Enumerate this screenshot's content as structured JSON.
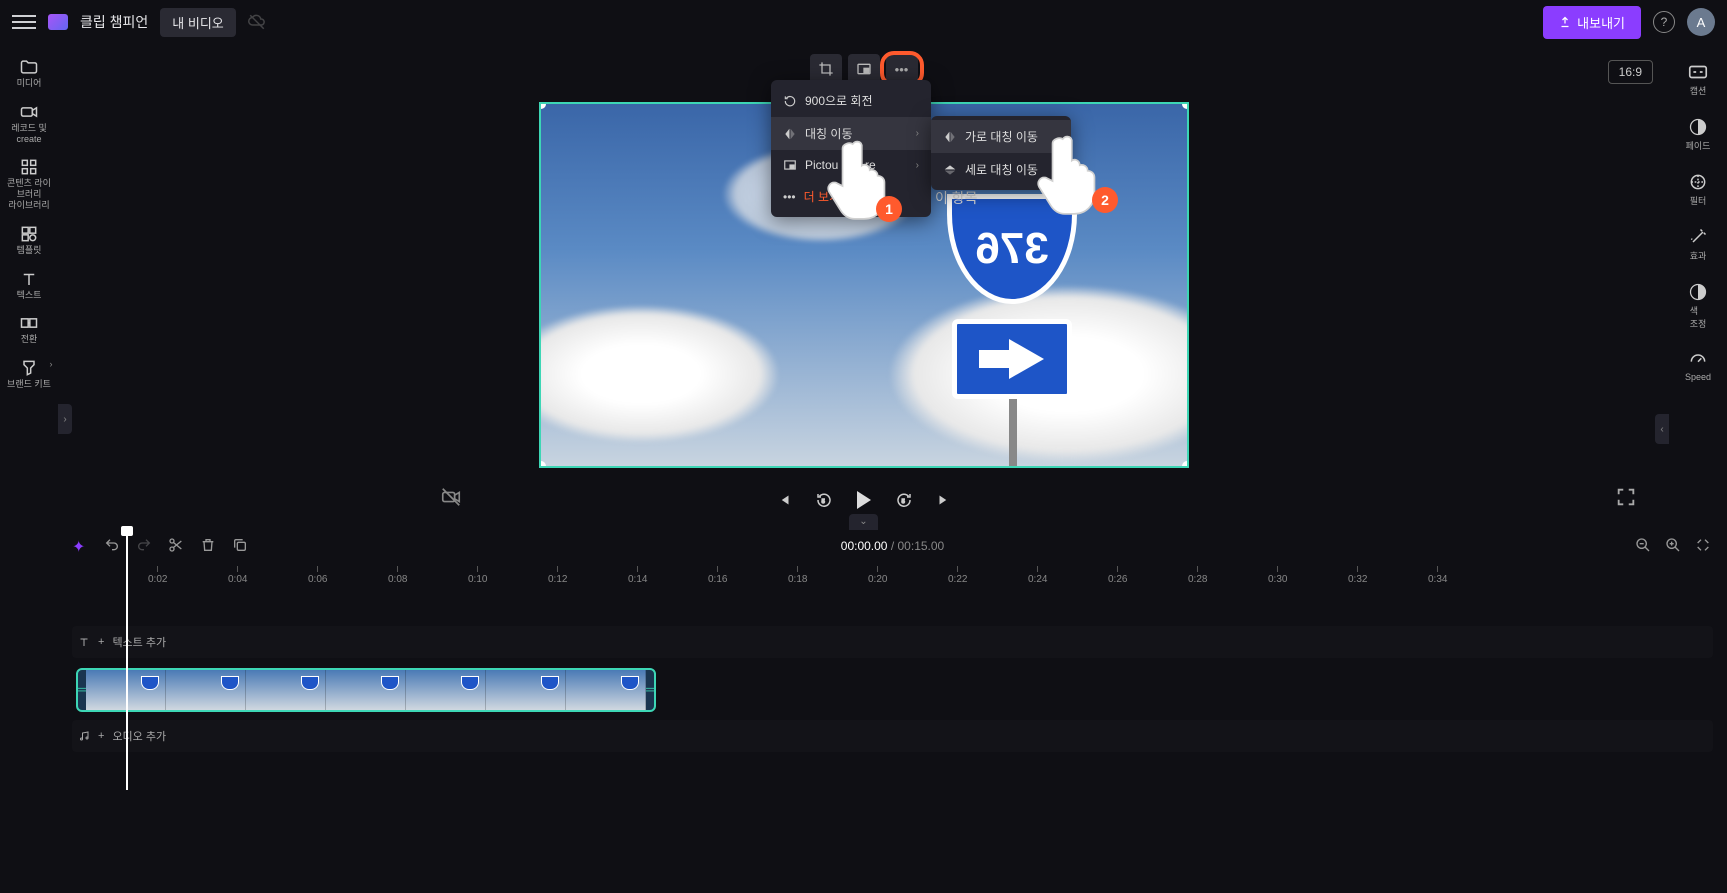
{
  "topbar": {
    "app_title": "클립 챔피언",
    "my_video": "내 비디오",
    "export": "내보내기",
    "avatar_initial": "A"
  },
  "left_sidebar": {
    "media": "미디어",
    "record": "레코드 및\ncreate",
    "contentlib": "콘텐츠 라이브러리\n라이브러리",
    "templates": "템플릿",
    "text": "텍스트",
    "transitions": "전환",
    "brandkit": "브랜드 키트"
  },
  "right_sidebar": {
    "captions": "캡션",
    "fade": "페이드",
    "filter": "필터",
    "effects": "효과",
    "color": "색\n조정",
    "speed": "Speed"
  },
  "canvas": {
    "aspect": "16:9",
    "sign_number": "376"
  },
  "context_menu": {
    "rotate": "900으로 회전",
    "flip": "대칭 이동",
    "pip": "Pictou e",
    "pip_suffix": "re",
    "more": "더 보기",
    "submenu_horizontal": "가로 대칭 이동",
    "submenu_vertical": "세로 대칭 이동",
    "group_label": "이 항목"
  },
  "pointer_badges": {
    "one": "1",
    "two": "2"
  },
  "timeline": {
    "current": "00:00.00",
    "total": "00:15.00",
    "ticks": [
      "0:02",
      "0:04",
      "0:06",
      "0:08",
      "0:10",
      "0:12",
      "0:14",
      "0:16",
      "0:18",
      "0:20",
      "0:22",
      "0:24",
      "0:26",
      "0:28",
      "0:30",
      "0:32",
      "0:34"
    ],
    "text_track": "텍스트 추가",
    "audio_track": "오디오 추가"
  }
}
